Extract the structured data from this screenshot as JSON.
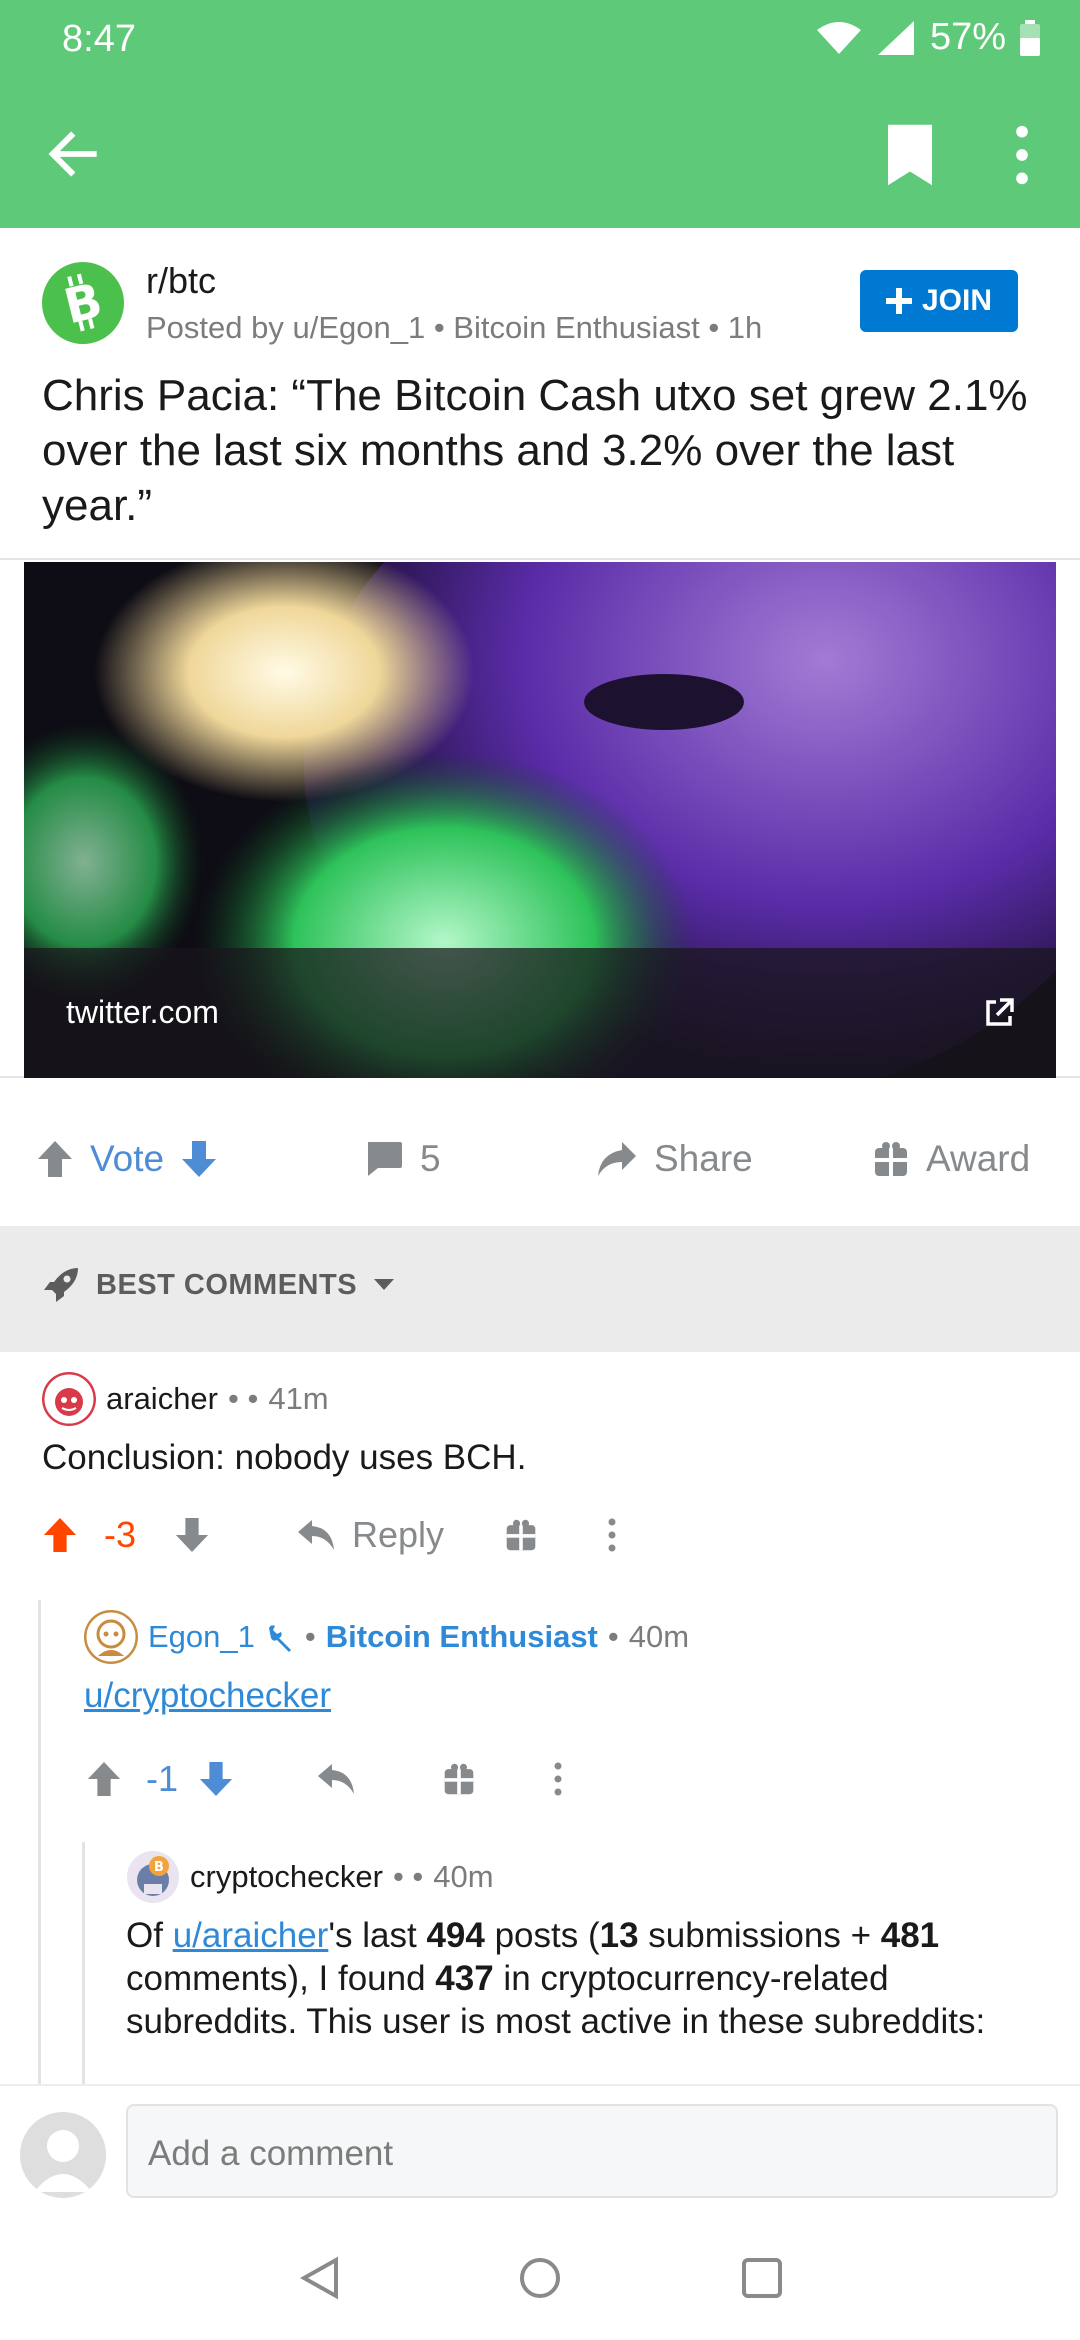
{
  "status_bar": {
    "time": "8:47",
    "battery": "57%"
  },
  "post": {
    "subreddit": "r/btc",
    "posted_by": "Posted by u/Egon_1 • Bitcoin Enthusiast • 1h",
    "join_label": "JOIN",
    "title": "Chris Pacia: “The Bitcoin Cash utxo set grew 2.1% over the last six months and 3.2% over the last year.”",
    "link_domain": "twitter.com"
  },
  "actions": {
    "vote_label": "Vote",
    "comment_count": "5",
    "share_label": "Share",
    "award_label": "Award"
  },
  "sort": {
    "label": "BEST COMMENTS"
  },
  "comments": [
    {
      "author": "araicher",
      "meta_sep": "•  •",
      "time": "41m",
      "body": "Conclusion: nobody uses BCH.",
      "score": "-3",
      "reply_label": "Reply"
    },
    {
      "author": "Egon_1",
      "sep1": "•",
      "flair": "Bitcoin Enthusiast",
      "sep2": "•",
      "time": "40m",
      "body_link": "u/cryptochecker",
      "score": "-1"
    },
    {
      "author": "cryptochecker",
      "meta_sep": "•  •",
      "time": "40m",
      "body": {
        "p1": "Of ",
        "link": "u/araicher",
        "p2": "'s last ",
        "posts": "494",
        "p3": " posts (",
        "submissions": "13",
        "p4": " submissions + ",
        "comments": "481",
        "p5": " comments), I found ",
        "found": "437",
        "p6": " in cryptocurrency-related subreddits. This user is most active in these subreddits:"
      }
    }
  ],
  "composer": {
    "placeholder": "Add a comment"
  },
  "colors": {
    "appbar": "#5ec978",
    "accent": "#0079d3",
    "downvote": "#ff4500"
  }
}
